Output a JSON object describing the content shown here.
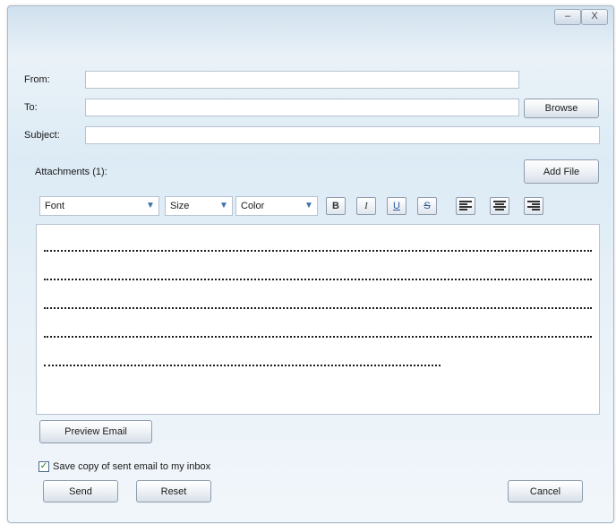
{
  "window": {
    "minimize_glyph": "–",
    "close_glyph": "X"
  },
  "form": {
    "from_label": "From:",
    "to_label": "To:",
    "subject_label": "Subject:",
    "from_value": "",
    "to_value": "",
    "subject_value": "",
    "browse_label": "Browse",
    "attachments_label": "Attachments (1):",
    "add_file_label": "Add File"
  },
  "toolbar": {
    "font": "Font",
    "size": "Size",
    "color": "Color",
    "bold": "B",
    "italic": "I",
    "underline": "U",
    "strike": "S"
  },
  "editor": {
    "lines": [
      "",
      "",
      "",
      "",
      ""
    ]
  },
  "actions": {
    "preview_label": "Preview Email",
    "save_copy_label": "Save copy of sent email to my inbox",
    "save_copy_checked": "✓",
    "send_label": "Send",
    "reset_label": "Reset",
    "cancel_label": "Cancel"
  }
}
